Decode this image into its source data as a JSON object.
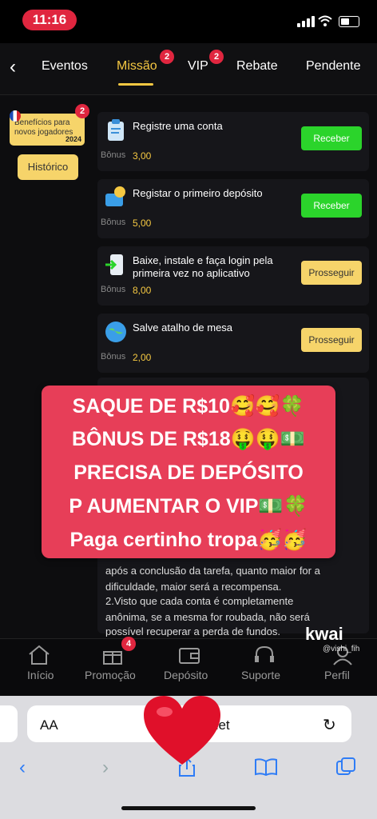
{
  "status": {
    "time": "11:16"
  },
  "nav": {
    "tabs": [
      {
        "label": "Eventos",
        "active": false,
        "badge": ""
      },
      {
        "label": "Missão",
        "active": true,
        "badge": "2"
      },
      {
        "label": "VIP",
        "active": false,
        "badge": "2"
      },
      {
        "label": "Rebate",
        "active": false,
        "badge": ""
      },
      {
        "label": "Pendente",
        "active": false,
        "badge": ""
      }
    ]
  },
  "sidebar": {
    "benefit_text": "Benefícios para novos jogadores",
    "benefit_badge": "2",
    "benefit_year": "2024",
    "history_label": "Histórico"
  },
  "tasks": [
    {
      "title": "Registre uma conta",
      "bonus_label": "Bônus",
      "bonus_value": "3,00",
      "button": "Receber",
      "button_style": "green"
    },
    {
      "title": "Registar o primeiro depósito",
      "bonus_label": "Bônus",
      "bonus_value": "5,00",
      "button": "Receber",
      "button_style": "green"
    },
    {
      "title": "Baixe, instale e faça login pela primeira vez no aplicativo",
      "bonus_label": "Bônus",
      "bonus_value": "8,00",
      "button": "Prosseguir",
      "button_style": "yellow"
    },
    {
      "title": "Salve atalho de mesa",
      "bonus_label": "Bônus",
      "bonus_value": "2,00",
      "button": "Prosseguir",
      "button_style": "yellow"
    }
  ],
  "rules": {
    "lines": [
      "após a conclusão da tarefa, quanto maior for a",
      "dificuldade, maior será a recompensa.",
      "2.Visto que cada conta é completamente",
      "anônima, se a mesma for roubada, não será",
      "possível recuperar a perda de fundos."
    ]
  },
  "banner": {
    "lines": [
      "SAQUE DE R$10🥰🥰🍀",
      "BÔNUS DE R$18🤑🤑💵",
      "PRECISA DE DEPÓSITO",
      "P AUMENTAR O VIP💵🍀",
      "Paga certinho tropa🥳🥳"
    ]
  },
  "appnav": {
    "items": [
      {
        "label": "Início",
        "icon": "home-icon"
      },
      {
        "label": "Promoção",
        "icon": "gift-icon",
        "badge": "4"
      },
      {
        "label": "Depósito",
        "icon": "wallet-icon"
      },
      {
        "label": "Suporte",
        "icon": "headset-icon"
      },
      {
        "label": "Perfil",
        "icon": "profile-icon"
      }
    ]
  },
  "watermark": {
    "brand": "kwai",
    "user": "@vishi_fih"
  },
  "safari": {
    "aa_label": "AA",
    "url_text": "net"
  },
  "colors": {
    "accent": "#f5c842",
    "green": "#2bd42b",
    "banner": "#e73e58",
    "badge": "#e0263f"
  }
}
